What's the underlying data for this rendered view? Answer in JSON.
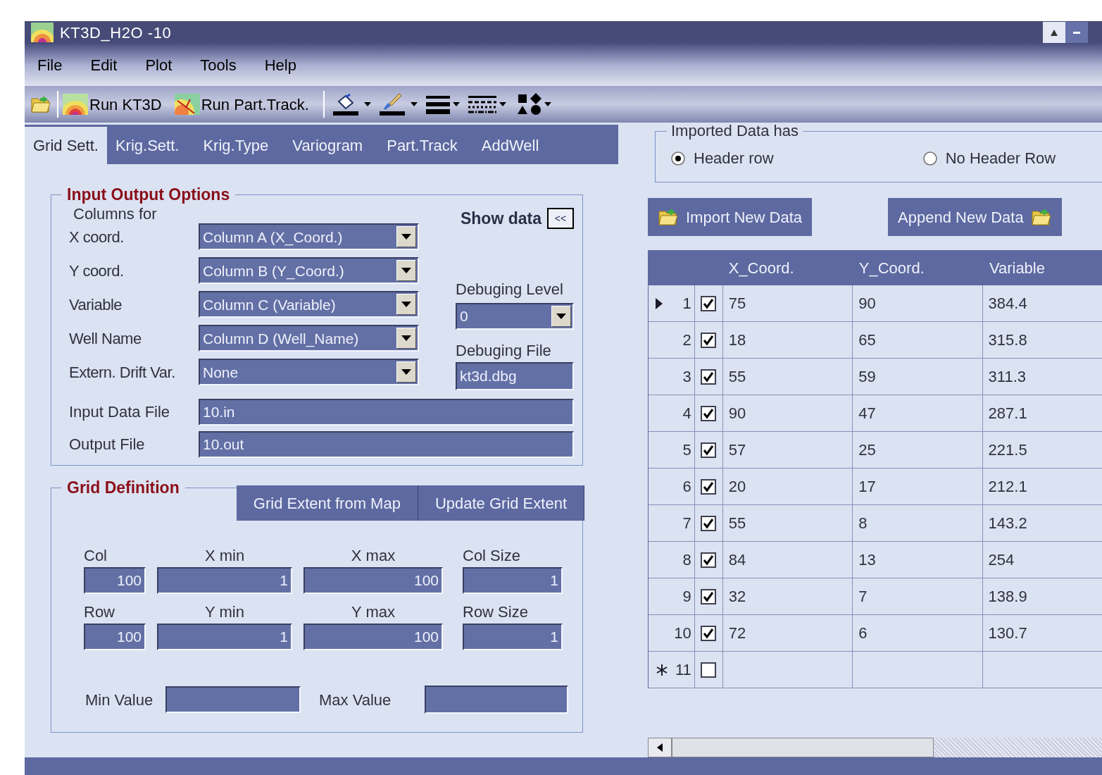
{
  "window": {
    "title": "KT3D_H2O -10"
  },
  "menu": [
    "File",
    "Edit",
    "Plot",
    "Tools",
    "Help"
  ],
  "toolbar": {
    "buttons": [
      "Run KT3D",
      "Run Part.Track."
    ]
  },
  "tabs": [
    {
      "label": "Grid Sett.",
      "selected": true
    },
    {
      "label": "Krig.Sett.",
      "selected": false
    },
    {
      "label": "Krig.Type",
      "selected": false
    },
    {
      "label": "Variogram",
      "selected": false
    },
    {
      "label": "Part.Track",
      "selected": false
    },
    {
      "label": "AddWell",
      "selected": false
    }
  ],
  "io_options": {
    "title": "Input Output Options",
    "columns_for": "Columns for",
    "show_data": "Show data",
    "show_data_button": "<<",
    "columns": [
      {
        "label": "X coord.",
        "value": "Column A (X_Coord.)"
      },
      {
        "label": "Y coord.",
        "value": "Column B (Y_Coord.)"
      },
      {
        "label": "Variable",
        "value": "Column C (Variable)"
      },
      {
        "label": "Well Name",
        "value": "Column D (Well_Name)"
      },
      {
        "label": "Extern. Drift Var.",
        "value": "None"
      }
    ],
    "debug_level": {
      "label": "Debuging Level",
      "value": "0"
    },
    "debug_file": {
      "label": "Debuging File",
      "value": "kt3d.dbg"
    },
    "files": [
      {
        "label": "Input Data File",
        "value": "10.in"
      },
      {
        "label": "Output File",
        "value": "10.out"
      }
    ]
  },
  "grid_definition": {
    "title": "Grid Definition",
    "buttons": [
      "Grid Extent from Map",
      "Update Grid Extent"
    ],
    "rows": [
      [
        {
          "label": "Col",
          "value": "100"
        },
        {
          "label": "X min",
          "value": "1"
        },
        {
          "label": "X max",
          "value": "100"
        },
        {
          "label": "Col Size",
          "value": "1"
        }
      ],
      [
        {
          "label": "Row",
          "value": "100"
        },
        {
          "label": "Y min",
          "value": "1"
        },
        {
          "label": "Y max",
          "value": "100"
        },
        {
          "label": "Row Size",
          "value": "1"
        }
      ]
    ],
    "min_value": {
      "label": "Min Value"
    },
    "max_value": {
      "label": "Max Value"
    }
  },
  "imported": {
    "title": "Imported Data has",
    "options": [
      {
        "label": "Header row",
        "selected": true
      },
      {
        "label": "No Header Row",
        "selected": false
      }
    ]
  },
  "data_buttons": [
    "Import New Data",
    "Append New Data"
  ],
  "table": {
    "columns": [
      "X_Coord.",
      "Y_Coord.",
      "Variable"
    ],
    "rows": [
      {
        "number": "1",
        "kind": "data",
        "current": true,
        "checked": true,
        "cells": [
          "75",
          "90",
          "384.4"
        ]
      },
      {
        "number": "2",
        "kind": "data",
        "current": false,
        "checked": true,
        "cells": [
          "18",
          "65",
          "315.8"
        ]
      },
      {
        "number": "3",
        "kind": "data",
        "current": false,
        "checked": true,
        "cells": [
          "55",
          "59",
          "311.3"
        ]
      },
      {
        "number": "4",
        "kind": "data",
        "current": false,
        "checked": true,
        "cells": [
          "90",
          "47",
          "287.1"
        ]
      },
      {
        "number": "5",
        "kind": "data",
        "current": false,
        "checked": true,
        "cells": [
          "57",
          "25",
          "221.5"
        ]
      },
      {
        "number": "6",
        "kind": "data",
        "current": false,
        "checked": true,
        "cells": [
          "20",
          "17",
          "212.1"
        ]
      },
      {
        "number": "7",
        "kind": "data",
        "current": false,
        "checked": true,
        "cells": [
          "55",
          "8",
          "143.2"
        ]
      },
      {
        "number": "8",
        "kind": "data",
        "current": false,
        "checked": true,
        "cells": [
          "84",
          "13",
          "254"
        ]
      },
      {
        "number": "9",
        "kind": "data",
        "current": false,
        "checked": true,
        "cells": [
          "32",
          "7",
          "138.9"
        ]
      },
      {
        "number": "10",
        "kind": "data",
        "current": false,
        "checked": true,
        "cells": [
          "72",
          "6",
          "130.7"
        ]
      },
      {
        "number": "11",
        "kind": "new",
        "current": false,
        "checked": false,
        "cells": []
      }
    ]
  }
}
